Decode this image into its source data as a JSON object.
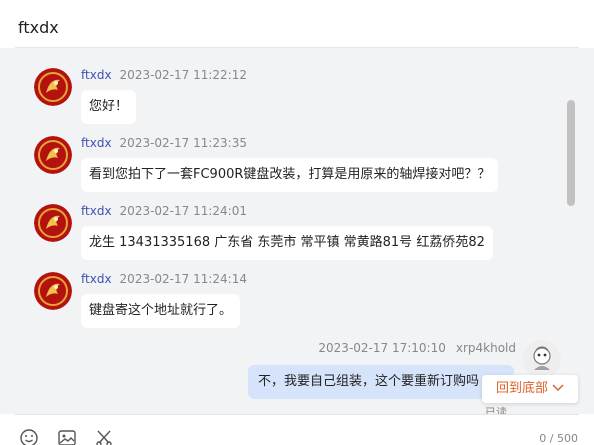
{
  "header": {
    "title": "ftxdx"
  },
  "messages": [
    {
      "sender": "ftxdx",
      "time": "2023-02-17 11:22:12",
      "text": "您好！"
    },
    {
      "sender": "ftxdx",
      "time": "2023-02-17 11:23:35",
      "text": "看到您拍下了一套FC900R键盘改装，打算是用原来的轴焊接对吧？？"
    },
    {
      "sender": "ftxdx",
      "time": "2023-02-17 11:24:01",
      "text": "龙生 13431335168  广东省 东莞市  常平镇  常黄路81号 红荔侨苑82"
    },
    {
      "sender": "ftxdx",
      "time": "2023-02-17 11:24:14",
      "text": "键盘寄这个地址就行了。"
    }
  ],
  "self_message": {
    "sender": "xrp4khold",
    "time": "2023-02-17 17:10:10",
    "text": "不，我要自己组装，这个要重新订购吗",
    "status": "已读"
  },
  "scroll_to_bottom": {
    "label": "回到底部"
  },
  "composer": {
    "tools": [
      "smile-icon",
      "image-icon",
      "scissors-icon"
    ],
    "counter": "0 / 500"
  },
  "colors": {
    "accent": "#e0602a",
    "name": "#3f51b5",
    "self_bubble": "#d6e4fb",
    "chat_bg": "#f2f3f5"
  }
}
